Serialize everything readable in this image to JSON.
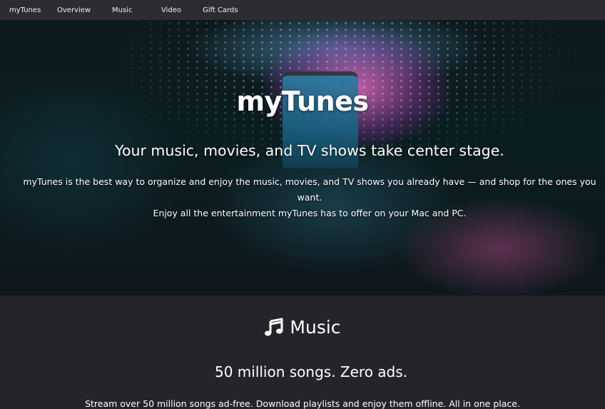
{
  "nav": {
    "brand": "myTunes",
    "items": [
      "Overview",
      "Music",
      "Video",
      "Gift Cards"
    ]
  },
  "hero": {
    "title": "myTunes",
    "subtitle": "Your music, movies, and TV shows take center stage.",
    "body_line1": "myTunes is the best way to organize and enjoy the music, movies, and TV shows you already have — and shop for the ones you want.",
    "body_line2": "Enjoy all the entertainment myTunes has to offer on your Mac and PC."
  },
  "music": {
    "icon": "music-note-icon",
    "heading": "Music",
    "tagline": "50 million songs. Zero ads.",
    "body": "Stream over 50 million songs ad-free. Download playlists and enjoy them offline. All in one place."
  }
}
